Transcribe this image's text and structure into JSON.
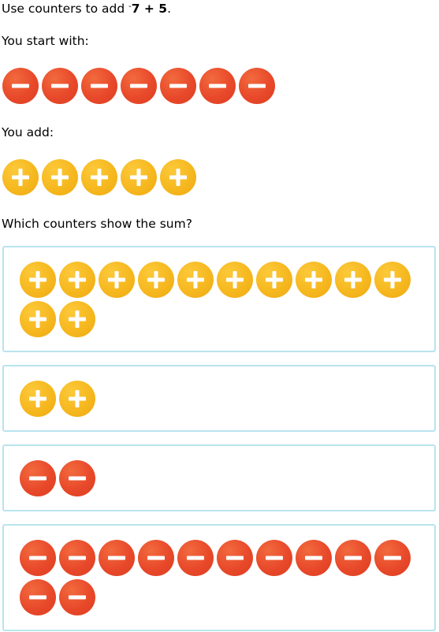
{
  "question": {
    "prompt_prefix": "Use counters to add ",
    "neg_sign": "-",
    "expression": "7 + 5",
    "period": ".",
    "start_label": "You start with:",
    "add_label": "You add:",
    "which_label": "Which counters show the sum?"
  },
  "start_counters": {
    "type": "negative",
    "count": 7
  },
  "add_counters": {
    "type": "positive",
    "count": 5
  },
  "choices": [
    {
      "type": "positive",
      "count": 12
    },
    {
      "type": "positive",
      "count": 2
    },
    {
      "type": "negative",
      "count": 2
    },
    {
      "type": "negative",
      "count": 12
    }
  ],
  "colors": {
    "negative_counter": "#e8492a",
    "positive_counter": "#f6b81f",
    "choice_border": "#b9e4ee",
    "counter_symbol": "#ffffff"
  },
  "icons": {
    "negative": "minus-icon",
    "positive": "plus-icon"
  }
}
